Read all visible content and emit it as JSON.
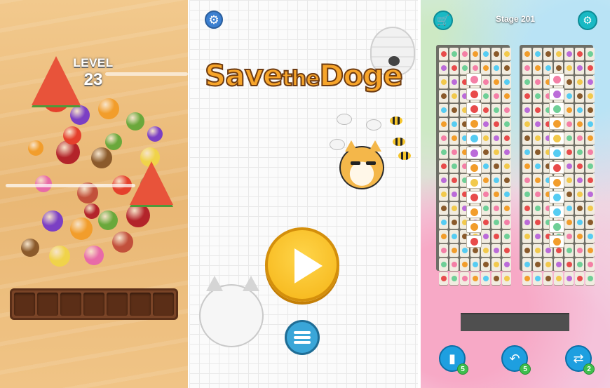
{
  "screens": {
    "fruit_match": {
      "level_label": "LEVEL",
      "level_number": "23",
      "tray_slots": 7
    },
    "save_the_doge": {
      "logo_part1": "Save",
      "logo_part2": "the",
      "logo_part3": "Doge",
      "settings_icon": "gear-icon",
      "play_icon": "play-icon",
      "menu_icon": "list-icon"
    },
    "tile_match": {
      "stage_label": "Stage 201",
      "shop_icon": "cart-icon",
      "settings_icon": "gear-icon",
      "tools": [
        {
          "icon": "card-icon",
          "count": "5"
        },
        {
          "icon": "undo-icon",
          "count": "5"
        },
        {
          "icon": "shuffle-icon",
          "count": "2"
        }
      ]
    }
  },
  "colors": {
    "wood_tray": "#7a4427",
    "play_button": "#f5b416",
    "menu_button": "#3aa6d8",
    "teal_button": "#19b9c4",
    "tool_button": "#1e9fe0",
    "badge_green": "#3fbe4d"
  }
}
